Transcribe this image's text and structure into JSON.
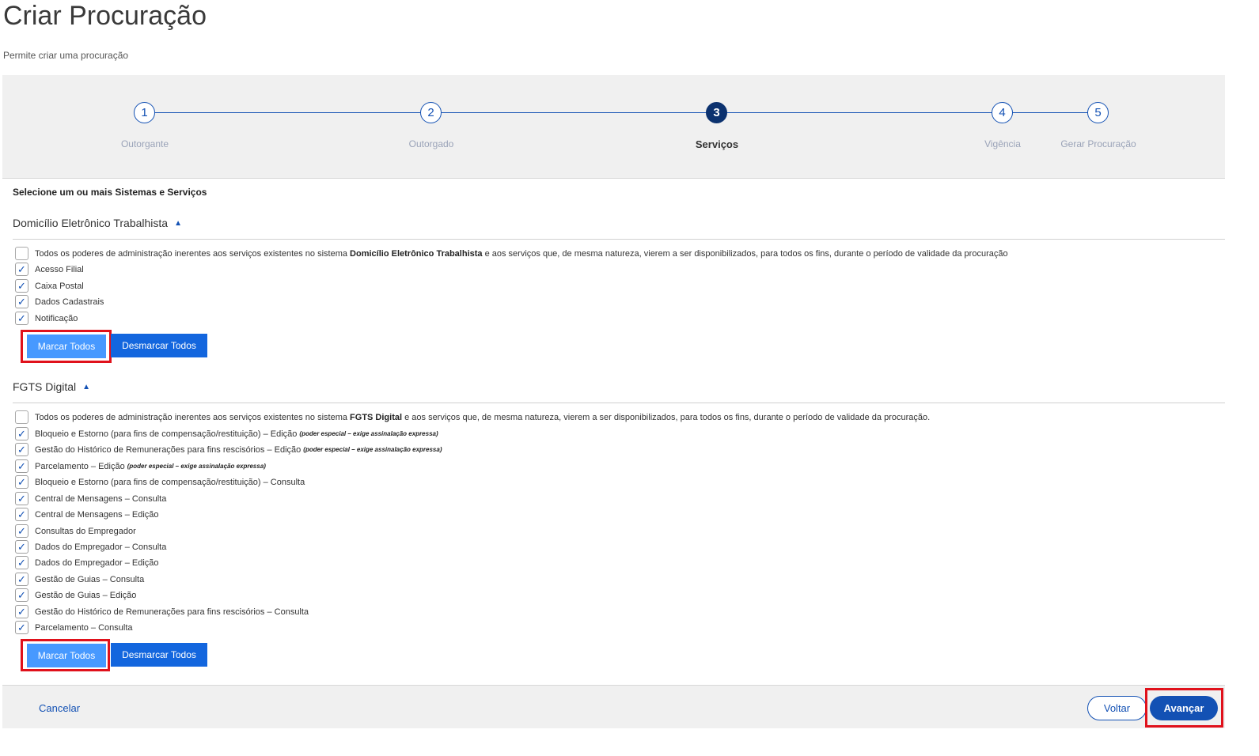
{
  "header": {
    "title": "Criar Procuração",
    "subtitle": "Permite criar uma procuração"
  },
  "stepper": {
    "steps": [
      {
        "number": "1",
        "label": "Outorgante"
      },
      {
        "number": "2",
        "label": "Outorgado"
      },
      {
        "number": "3",
        "label": "Serviços"
      },
      {
        "number": "4",
        "label": "Vigência"
      },
      {
        "number": "5",
        "label": "Gerar Procuração"
      }
    ],
    "active_step": 3
  },
  "instruction": "Selecione um ou mais Sistemas e Serviços",
  "sections": [
    {
      "title": "Domicílio Eletrônico Trabalhista",
      "all_powers": {
        "prefix": "Todos os poderes de administração inerentes aos serviços existentes no sistema ",
        "system": "Domicílio Eletrônico Trabalhista",
        "suffix": " e aos serviços que, de mesma natureza, vierem a ser disponibilizados, para todos os fins, durante o período de validade da procuração",
        "checked": false
      },
      "services": [
        {
          "label": "Acesso Filial",
          "checked": true
        },
        {
          "label": "Caixa Postal",
          "checked": true
        },
        {
          "label": "Dados Cadastrais",
          "checked": true
        },
        {
          "label": "Notificação",
          "checked": true
        }
      ],
      "mark_all_label": "Marcar Todos",
      "unmark_all_label": "Desmarcar Todos"
    },
    {
      "title": "FGTS Digital",
      "all_powers": {
        "prefix": "Todos os poderes de administração inerentes aos serviços existentes no sistema ",
        "system": "FGTS Digital",
        "suffix": " e aos serviços que, de mesma natureza, vierem a ser disponibilizados, para todos os fins, durante o período de validade da procuração.",
        "checked": false
      },
      "services": [
        {
          "label": "Bloqueio e Estorno (para fins de compensação/restituição) – Edição",
          "note": "(poder especial – exige assinalação expressa)",
          "checked": true
        },
        {
          "label": "Gestão do Histórico de Remunerações para fins rescisórios – Edição",
          "note": "(poder especial – exige assinalação expressa)",
          "checked": true
        },
        {
          "label": "Parcelamento – Edição",
          "note": "(poder especial – exige assinalação expressa)",
          "checked": true
        },
        {
          "label": "Bloqueio e Estorno (para fins de compensação/restituição) – Consulta",
          "checked": true
        },
        {
          "label": "Central de Mensagens – Consulta",
          "checked": true
        },
        {
          "label": "Central de Mensagens – Edição",
          "checked": true
        },
        {
          "label": "Consultas do Empregador",
          "checked": true
        },
        {
          "label": "Dados do Empregador – Consulta",
          "checked": true
        },
        {
          "label": "Dados do Empregador – Edição",
          "checked": true
        },
        {
          "label": "Gestão de Guias – Consulta",
          "checked": true
        },
        {
          "label": "Gestão de Guias – Edição",
          "checked": true
        },
        {
          "label": "Gestão do Histórico de Remunerações para fins rescisórios – Consulta",
          "checked": true
        },
        {
          "label": "Parcelamento – Consulta",
          "checked": true
        }
      ],
      "mark_all_label": "Marcar Todos",
      "unmark_all_label": "Desmarcar Todos"
    }
  ],
  "footer": {
    "cancel_label": "Cancelar",
    "back_label": "Voltar",
    "next_label": "Avançar"
  },
  "colors": {
    "primary": "#1351b4",
    "active_step": "#0c326f",
    "mark_button": "#4799ff",
    "unmark_button": "#1366de",
    "highlight": "#e0111b"
  }
}
